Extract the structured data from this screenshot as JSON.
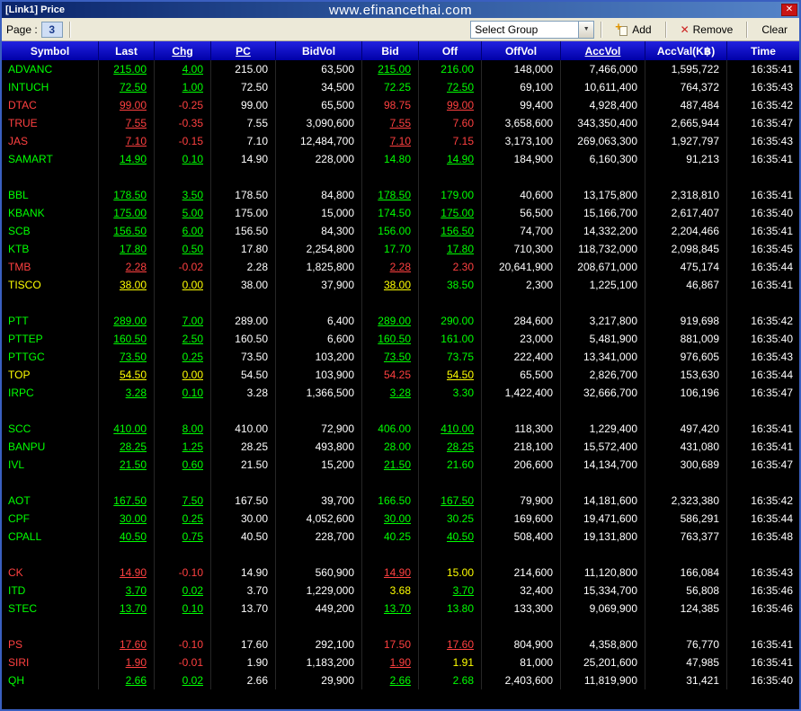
{
  "window": {
    "title": "[Link1] Price",
    "website": "www.efinancethai.com",
    "close": "✕"
  },
  "toolbar": {
    "page_label": "Page :",
    "page_value": "3",
    "group_value": "Select Group",
    "add": "Add",
    "remove": "Remove",
    "clear": "Clear"
  },
  "colors": {
    "g": "#00ff00",
    "r": "#ff4040",
    "y": "#ffff00",
    "w": "#ffffff"
  },
  "table": {
    "columns": [
      {
        "label": "Symbol",
        "underline": false
      },
      {
        "label": "Last",
        "underline": false
      },
      {
        "label": "Chg",
        "underline": true
      },
      {
        "label": "PC",
        "underline": true
      },
      {
        "label": "BidVol",
        "underline": false
      },
      {
        "label": "Bid",
        "underline": false
      },
      {
        "label": "Off",
        "underline": false
      },
      {
        "label": "OffVol",
        "underline": false
      },
      {
        "label": "AccVol",
        "underline": true
      },
      {
        "label": "AccVal(K฿)",
        "underline": false
      },
      {
        "label": "Time",
        "underline": false
      }
    ],
    "rows": [
      {
        "sym": "ADVANC",
        "c": "g",
        "last": "215.00",
        "chg": "4.00",
        "chgU": true,
        "pc": "215.00",
        "bv": "63,500",
        "bid": "215.00",
        "bidC": "g",
        "bidU": true,
        "off": "216.00",
        "offC": "g",
        "offU": false,
        "ov": "148,000",
        "av": "7,466,000",
        "aval": "1,595,722",
        "t": "16:35:41"
      },
      {
        "sym": "INTUCH",
        "c": "g",
        "last": "72.50",
        "chg": "1.00",
        "chgU": true,
        "pc": "72.50",
        "bv": "34,500",
        "bid": "72.25",
        "bidC": "g",
        "bidU": false,
        "off": "72.50",
        "offC": "g",
        "offU": true,
        "ov": "69,100",
        "av": "10,611,400",
        "aval": "764,372",
        "t": "16:35:43"
      },
      {
        "sym": "DTAC",
        "c": "r",
        "last": "99.00",
        "chg": "-0.25",
        "chgU": false,
        "pc": "99.00",
        "bv": "65,500",
        "bid": "98.75",
        "bidC": "r",
        "bidU": false,
        "off": "99.00",
        "offC": "r",
        "offU": true,
        "ov": "99,400",
        "av": "4,928,400",
        "aval": "487,484",
        "t": "16:35:42"
      },
      {
        "sym": "TRUE",
        "c": "r",
        "last": "7.55",
        "chg": "-0.35",
        "chgU": false,
        "pc": "7.55",
        "bv": "3,090,600",
        "bid": "7.55",
        "bidC": "r",
        "bidU": true,
        "off": "7.60",
        "offC": "r",
        "offU": false,
        "ov": "3,658,600",
        "av": "343,350,400",
        "aval": "2,665,944",
        "t": "16:35:47"
      },
      {
        "sym": "JAS",
        "c": "r",
        "last": "7.10",
        "chg": "-0.15",
        "chgU": false,
        "pc": "7.10",
        "bv": "12,484,700",
        "bid": "7.10",
        "bidC": "r",
        "bidU": true,
        "off": "7.15",
        "offC": "r",
        "offU": false,
        "ov": "3,173,100",
        "av": "269,063,300",
        "aval": "1,927,797",
        "t": "16:35:43"
      },
      {
        "sym": "SAMART",
        "c": "g",
        "last": "14.90",
        "chg": "0.10",
        "chgU": true,
        "pc": "14.90",
        "bv": "228,000",
        "bid": "14.80",
        "bidC": "g",
        "bidU": false,
        "off": "14.90",
        "offC": "g",
        "offU": true,
        "ov": "184,900",
        "av": "6,160,300",
        "aval": "91,213",
        "t": "16:35:41"
      },
      {
        "spacer": true
      },
      {
        "sym": "BBL",
        "c": "g",
        "last": "178.50",
        "chg": "3.50",
        "chgU": true,
        "pc": "178.50",
        "bv": "84,800",
        "bid": "178.50",
        "bidC": "g",
        "bidU": true,
        "off": "179.00",
        "offC": "g",
        "offU": false,
        "ov": "40,600",
        "av": "13,175,800",
        "aval": "2,318,810",
        "t": "16:35:41"
      },
      {
        "sym": "KBANK",
        "c": "g",
        "last": "175.00",
        "chg": "5.00",
        "chgU": true,
        "pc": "175.00",
        "bv": "15,000",
        "bid": "174.50",
        "bidC": "g",
        "bidU": false,
        "off": "175.00",
        "offC": "g",
        "offU": true,
        "ov": "56,500",
        "av": "15,166,700",
        "aval": "2,617,407",
        "t": "16:35:40"
      },
      {
        "sym": "SCB",
        "c": "g",
        "last": "156.50",
        "chg": "6.00",
        "chgU": true,
        "pc": "156.50",
        "bv": "84,300",
        "bid": "156.00",
        "bidC": "g",
        "bidU": false,
        "off": "156.50",
        "offC": "g",
        "offU": true,
        "ov": "74,700",
        "av": "14,332,200",
        "aval": "2,204,466",
        "t": "16:35:41"
      },
      {
        "sym": "KTB",
        "c": "g",
        "last": "17.80",
        "chg": "0.50",
        "chgU": true,
        "pc": "17.80",
        "bv": "2,254,800",
        "bid": "17.70",
        "bidC": "g",
        "bidU": false,
        "off": "17.80",
        "offC": "g",
        "offU": true,
        "ov": "710,300",
        "av": "118,732,000",
        "aval": "2,098,845",
        "t": "16:35:45"
      },
      {
        "sym": "TMB",
        "c": "r",
        "last": "2.28",
        "chg": "-0.02",
        "chgU": false,
        "pc": "2.28",
        "bv": "1,825,800",
        "bid": "2.28",
        "bidC": "r",
        "bidU": true,
        "off": "2.30",
        "offC": "r",
        "offU": false,
        "ov": "20,641,900",
        "av": "208,671,000",
        "aval": "475,174",
        "t": "16:35:44"
      },
      {
        "sym": "TISCO",
        "c": "y",
        "last": "38.00",
        "chg": "0.00",
        "chgU": true,
        "pc": "38.00",
        "bv": "37,900",
        "bid": "38.00",
        "bidC": "y",
        "bidU": true,
        "off": "38.50",
        "offC": "g",
        "offU": false,
        "ov": "2,300",
        "av": "1,225,100",
        "aval": "46,867",
        "t": "16:35:41"
      },
      {
        "spacer": true
      },
      {
        "sym": "PTT",
        "c": "g",
        "last": "289.00",
        "chg": "7.00",
        "chgU": true,
        "pc": "289.00",
        "bv": "6,400",
        "bid": "289.00",
        "bidC": "g",
        "bidU": true,
        "off": "290.00",
        "offC": "g",
        "offU": false,
        "ov": "284,600",
        "av": "3,217,800",
        "aval": "919,698",
        "t": "16:35:42"
      },
      {
        "sym": "PTTEP",
        "c": "g",
        "last": "160.50",
        "chg": "2.50",
        "chgU": true,
        "pc": "160.50",
        "bv": "6,600",
        "bid": "160.50",
        "bidC": "g",
        "bidU": true,
        "off": "161.00",
        "offC": "g",
        "offU": false,
        "ov": "23,000",
        "av": "5,481,900",
        "aval": "881,009",
        "t": "16:35:40"
      },
      {
        "sym": "PTTGC",
        "c": "g",
        "last": "73.50",
        "chg": "0.25",
        "chgU": true,
        "pc": "73.50",
        "bv": "103,200",
        "bid": "73.50",
        "bidC": "g",
        "bidU": true,
        "off": "73.75",
        "offC": "g",
        "offU": false,
        "ov": "222,400",
        "av": "13,341,000",
        "aval": "976,605",
        "t": "16:35:43"
      },
      {
        "sym": "TOP",
        "c": "y",
        "last": "54.50",
        "chg": "0.00",
        "chgU": true,
        "pc": "54.50",
        "bv": "103,900",
        "bid": "54.25",
        "bidC": "r",
        "bidU": false,
        "off": "54.50",
        "offC": "y",
        "offU": true,
        "ov": "65,500",
        "av": "2,826,700",
        "aval": "153,630",
        "t": "16:35:44"
      },
      {
        "sym": "IRPC",
        "c": "g",
        "last": "3.28",
        "chg": "0.10",
        "chgU": true,
        "pc": "3.28",
        "bv": "1,366,500",
        "bid": "3.28",
        "bidC": "g",
        "bidU": true,
        "off": "3.30",
        "offC": "g",
        "offU": false,
        "ov": "1,422,400",
        "av": "32,666,700",
        "aval": "106,196",
        "t": "16:35:47"
      },
      {
        "spacer": true
      },
      {
        "sym": "SCC",
        "c": "g",
        "last": "410.00",
        "chg": "8.00",
        "chgU": true,
        "pc": "410.00",
        "bv": "72,900",
        "bid": "406.00",
        "bidC": "g",
        "bidU": false,
        "off": "410.00",
        "offC": "g",
        "offU": true,
        "ov": "118,300",
        "av": "1,229,400",
        "aval": "497,420",
        "t": "16:35:41"
      },
      {
        "sym": "BANPU",
        "c": "g",
        "last": "28.25",
        "chg": "1.25",
        "chgU": true,
        "pc": "28.25",
        "bv": "493,800",
        "bid": "28.00",
        "bidC": "g",
        "bidU": false,
        "off": "28.25",
        "offC": "g",
        "offU": true,
        "ov": "218,100",
        "av": "15,572,400",
        "aval": "431,080",
        "t": "16:35:41"
      },
      {
        "sym": "IVL",
        "c": "g",
        "last": "21.50",
        "chg": "0.60",
        "chgU": true,
        "pc": "21.50",
        "bv": "15,200",
        "bid": "21.50",
        "bidC": "g",
        "bidU": true,
        "off": "21.60",
        "offC": "g",
        "offU": false,
        "ov": "206,600",
        "av": "14,134,700",
        "aval": "300,689",
        "t": "16:35:47"
      },
      {
        "spacer": true
      },
      {
        "sym": "AOT",
        "c": "g",
        "last": "167.50",
        "chg": "7.50",
        "chgU": true,
        "pc": "167.50",
        "bv": "39,700",
        "bid": "166.50",
        "bidC": "g",
        "bidU": false,
        "off": "167.50",
        "offC": "g",
        "offU": true,
        "ov": "79,900",
        "av": "14,181,600",
        "aval": "2,323,380",
        "t": "16:35:42"
      },
      {
        "sym": "CPF",
        "c": "g",
        "last": "30.00",
        "chg": "0.25",
        "chgU": true,
        "pc": "30.00",
        "bv": "4,052,600",
        "bid": "30.00",
        "bidC": "g",
        "bidU": true,
        "off": "30.25",
        "offC": "g",
        "offU": false,
        "ov": "169,600",
        "av": "19,471,600",
        "aval": "586,291",
        "t": "16:35:44"
      },
      {
        "sym": "CPALL",
        "c": "g",
        "last": "40.50",
        "chg": "0.75",
        "chgU": true,
        "pc": "40.50",
        "bv": "228,700",
        "bid": "40.25",
        "bidC": "g",
        "bidU": false,
        "off": "40.50",
        "offC": "g",
        "offU": true,
        "ov": "508,400",
        "av": "19,131,800",
        "aval": "763,377",
        "t": "16:35:48"
      },
      {
        "spacer": true
      },
      {
        "sym": "CK",
        "c": "r",
        "last": "14.90",
        "chg": "-0.10",
        "chgU": false,
        "pc": "14.90",
        "bv": "560,900",
        "bid": "14.90",
        "bidC": "r",
        "bidU": true,
        "off": "15.00",
        "offC": "y",
        "offU": false,
        "ov": "214,600",
        "av": "11,120,800",
        "aval": "166,084",
        "t": "16:35:43"
      },
      {
        "sym": "ITD",
        "c": "g",
        "last": "3.70",
        "chg": "0.02",
        "chgU": true,
        "pc": "3.70",
        "bv": "1,229,000",
        "bid": "3.68",
        "bidC": "y",
        "bidU": false,
        "off": "3.70",
        "offC": "g",
        "offU": true,
        "ov": "32,400",
        "av": "15,334,700",
        "aval": "56,808",
        "t": "16:35:46"
      },
      {
        "sym": "STEC",
        "c": "g",
        "last": "13.70",
        "chg": "0.10",
        "chgU": true,
        "pc": "13.70",
        "bv": "449,200",
        "bid": "13.70",
        "bidC": "g",
        "bidU": true,
        "off": "13.80",
        "offC": "g",
        "offU": false,
        "ov": "133,300",
        "av": "9,069,900",
        "aval": "124,385",
        "t": "16:35:46"
      },
      {
        "spacer": true
      },
      {
        "sym": "PS",
        "c": "r",
        "last": "17.60",
        "chg": "-0.10",
        "chgU": false,
        "pc": "17.60",
        "bv": "292,100",
        "bid": "17.50",
        "bidC": "r",
        "bidU": false,
        "off": "17.60",
        "offC": "r",
        "offU": true,
        "ov": "804,900",
        "av": "4,358,800",
        "aval": "76,770",
        "t": "16:35:41"
      },
      {
        "sym": "SIRI",
        "c": "r",
        "last": "1.90",
        "chg": "-0.01",
        "chgU": false,
        "pc": "1.90",
        "bv": "1,183,200",
        "bid": "1.90",
        "bidC": "r",
        "bidU": true,
        "off": "1.91",
        "offC": "y",
        "offU": false,
        "ov": "81,000",
        "av": "25,201,600",
        "aval": "47,985",
        "t": "16:35:41"
      },
      {
        "sym": "QH",
        "c": "g",
        "last": "2.66",
        "chg": "0.02",
        "chgU": true,
        "pc": "2.66",
        "bv": "29,900",
        "bid": "2.66",
        "bidC": "g",
        "bidU": true,
        "off": "2.68",
        "offC": "g",
        "offU": false,
        "ov": "2,403,600",
        "av": "11,819,900",
        "aval": "31,421",
        "t": "16:35:40"
      }
    ]
  }
}
